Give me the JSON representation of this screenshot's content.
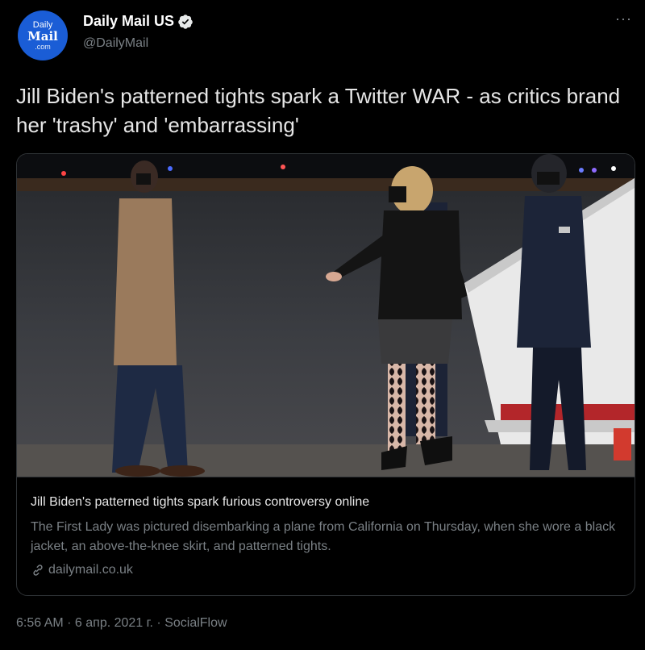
{
  "account": {
    "avatar_line1": "Daily",
    "avatar_line2": "Mail",
    "avatar_line3": ".com",
    "display_name": "Daily Mail US",
    "handle": "@DailyMail",
    "verified": true,
    "more_label": "···"
  },
  "tweet": {
    "text": "Jill Biden's patterned tights spark a Twitter WAR - as critics brand her 'trashy' and 'embarrassing'"
  },
  "card": {
    "title": "Jill Biden's patterned tights spark furious controversy online",
    "description": "The First Lady was pictured disembarking a plane from California on Thursday, when she wore a black jacket, an above-the-knee skirt, and patterned tights.",
    "domain": "dailymail.co.uk"
  },
  "meta": {
    "time": "6:56 AM",
    "separator": " · ",
    "date": "6 апр. 2021 г.",
    "source": "SocialFlow"
  },
  "colors": {
    "background": "#000000",
    "brand_blue": "#1a5dd6",
    "secondary_text": "#7a8085",
    "border": "#2f3336"
  }
}
